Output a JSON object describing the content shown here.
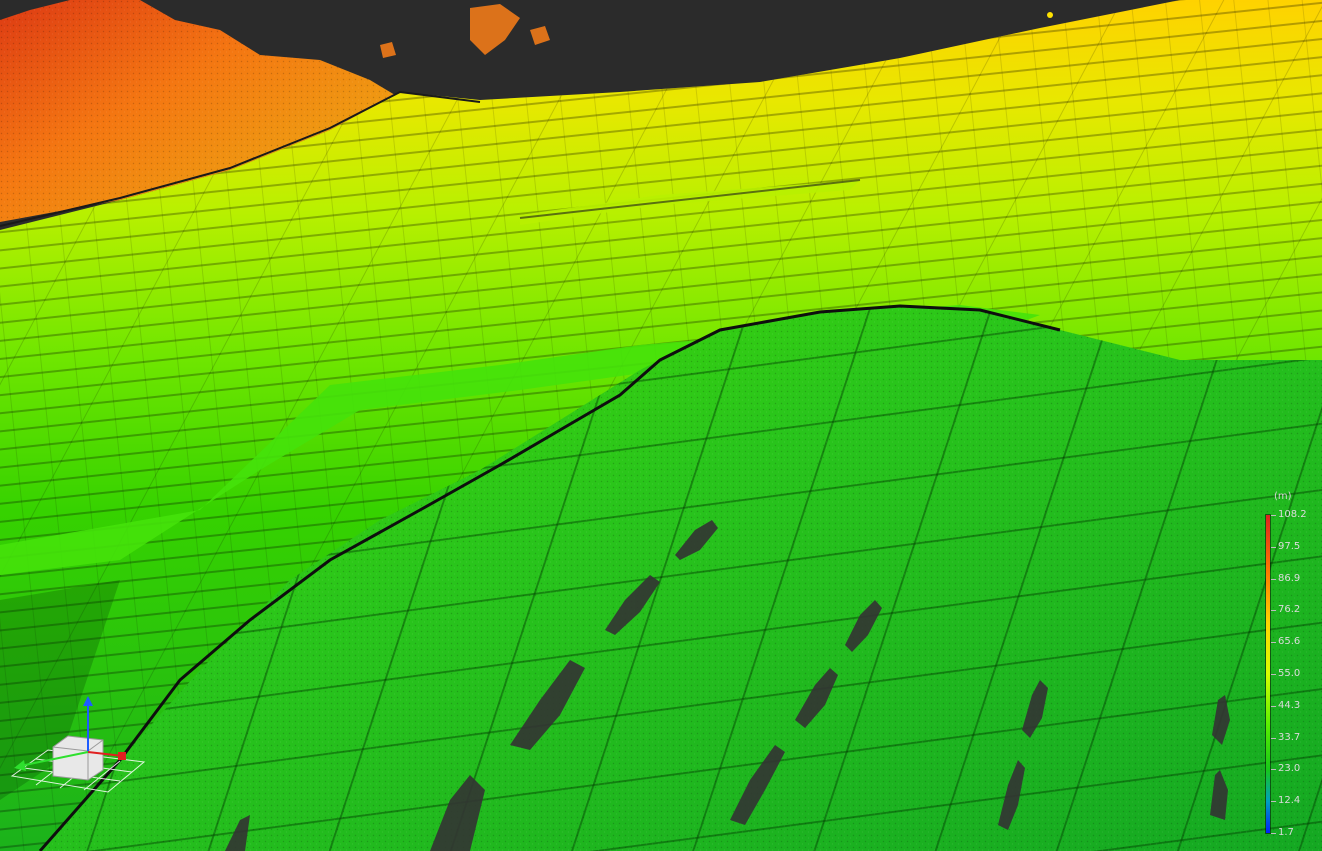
{
  "viewer": {
    "background_color": "#2b2b2b",
    "accent_low": "#0020ff",
    "accent_high": "#e02020"
  },
  "legend": {
    "unit": "(m)",
    "ticks": [
      "108.2",
      "97.5",
      "86.9",
      "76.2",
      "65.6",
      "55.0",
      "44.3",
      "33.7",
      "23.0",
      "12.4",
      "1.7"
    ]
  },
  "gizmo": {
    "axes": [
      "X",
      "Y",
      "Z"
    ],
    "icon": "axis-orientation-icon"
  }
}
